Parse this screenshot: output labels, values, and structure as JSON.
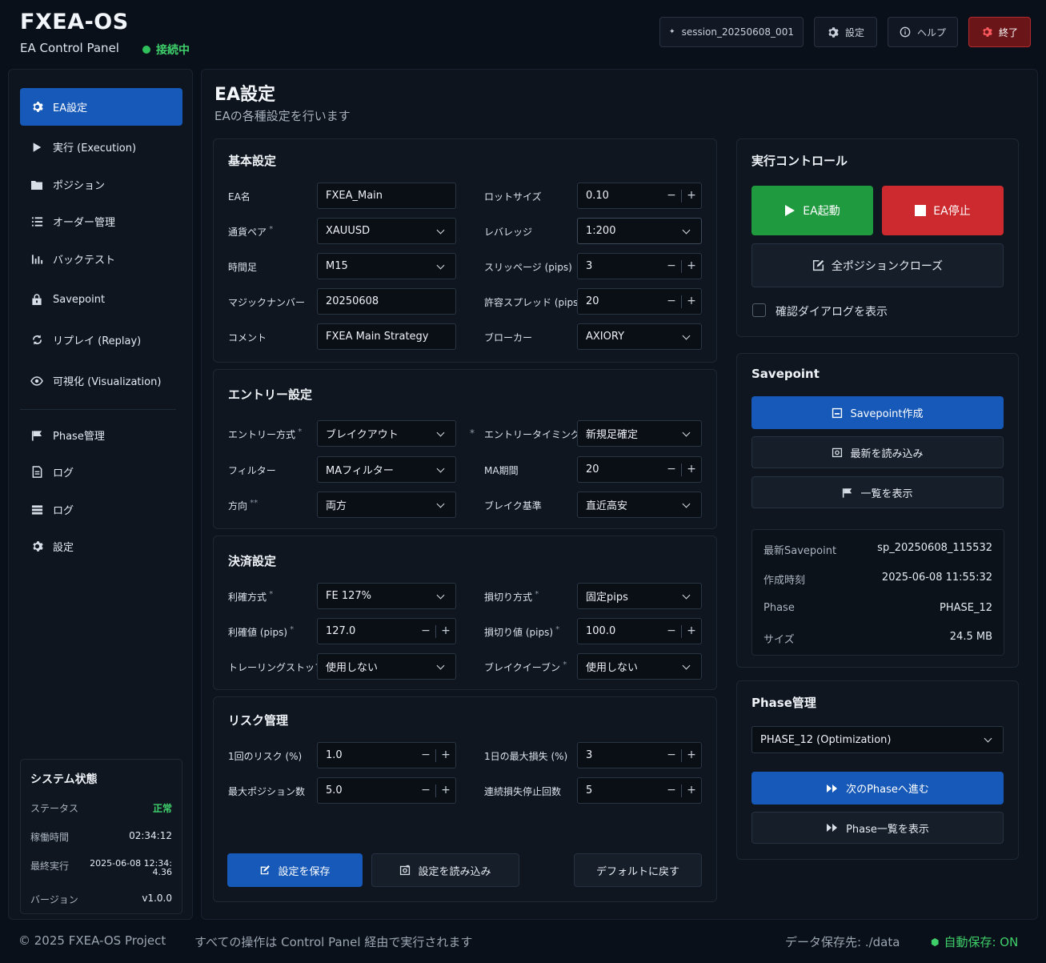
{
  "app": {
    "name": "FXEA-OS",
    "subtitle": "EA Control Panel",
    "status": "接続中"
  },
  "header": {
    "session": "session_20250608_001",
    "settings": "設定",
    "help": "ヘルプ",
    "exit": "終了"
  },
  "sidebar": {
    "items": [
      {
        "label": "EA設定",
        "icon": "gear-icon"
      },
      {
        "label": "実行 (Execution)",
        "icon": "play-icon"
      },
      {
        "label": "ポジション",
        "icon": "folder-icon"
      },
      {
        "label": "オーダー管理",
        "icon": "list-icon"
      },
      {
        "label": "バックテスト",
        "icon": "chart-icon"
      },
      {
        "label": "Savepoint",
        "icon": "lock-icon"
      },
      {
        "label": "リプレイ (Replay)",
        "icon": "replay-icon"
      },
      {
        "label": "可視化 (Visualization)",
        "icon": "eye-icon"
      },
      {
        "label": "Phase管理",
        "icon": "flag-icon"
      },
      {
        "label": "ログ",
        "icon": "document-icon"
      },
      {
        "label": "ログ",
        "icon": "stack-icon"
      },
      {
        "label": "設定",
        "icon": "gear-icon"
      }
    ],
    "system": {
      "title": "システム状態",
      "status_label": "ステータス",
      "status_value": "正常",
      "uptime_label": "稼働時間",
      "uptime_value": "02:34:12",
      "last_label": "最終実行",
      "last_value_1": "2025-06-08 12:34:",
      "last_value_2": "4.36",
      "version_label": "バージョン",
      "version_value": "v1.0.0"
    }
  },
  "page": {
    "title": "EA設定",
    "subtitle": "EAの各種設定を行います"
  },
  "basic": {
    "title": "基本設定",
    "ea_name_label": "EA名",
    "ea_name": "FXEA_Main",
    "pair_label": "通貨ペア",
    "pair": "XAUUSD",
    "timeframe_label": "時間足",
    "timeframe": "M15",
    "magic_label": "マジックナンバー",
    "magic": "20250608",
    "comment_label": "コメント",
    "comment": "FXEA Main Strategy",
    "lot_label": "ロットサイズ",
    "lot": "0.10",
    "leverage_label": "レバレッジ",
    "leverage": "1:200",
    "slippage_label": "スリッページ (pips)",
    "slippage": "3",
    "spread_label": "許容スプレッド (pips)",
    "spread": "20",
    "broker_label": "ブローカー",
    "broker": "AXIORY"
  },
  "entry": {
    "title": "エントリー設定",
    "method_label": "エントリー方式",
    "method": "ブレイクアウト",
    "filter_label": "フィルター",
    "filter": "MAフィルター",
    "direction_label": "方向",
    "direction": "両方",
    "timing_label": "エントリータイミング",
    "timing": "新規足確定",
    "ma_label": "MA期間",
    "ma": "20",
    "break_label": "ブレイク基準",
    "break": "直近高安"
  },
  "exit": {
    "title": "決済設定",
    "tp_method_label": "利確方式",
    "tp_method": "FE 127%",
    "tp_value_label": "利確値 (pips)",
    "tp_value": "127.0",
    "trailing_label": "トレーリングストップ",
    "trailing": "使用しない",
    "sl_method_label": "損切り方式",
    "sl_method": "固定pips",
    "sl_value_label": "損切り値 (pips)",
    "sl_value": "100.0",
    "breakeven_label": "ブレイクイーブン",
    "breakeven": "使用しない"
  },
  "risk": {
    "title": "リスク管理",
    "risk_label": "1回のリスク (%)",
    "risk": "1.0",
    "maxpos_label": "最大ポジション数",
    "maxpos": "5.0",
    "daily_label": "1日の最大損失 (%)",
    "daily": "3",
    "consec_label": "連続損失停止回数",
    "consec": "5"
  },
  "actions": {
    "save": "設定を保存",
    "load": "設定を読み込み",
    "default": "デフォルトに戻す"
  },
  "control": {
    "title": "実行コントロール",
    "start": "EA起動",
    "stop": "EA停止",
    "close_all": "全ポジションクローズ",
    "confirm": "確認ダイアログを表示"
  },
  "savepoint": {
    "title": "Savepoint",
    "create": "Savepoint作成",
    "load_latest": "最新を読み込み",
    "list": "一覧を表示",
    "latest_label": "最新Savepoint",
    "latest": "sp_20250608_115532",
    "created_label": "作成時刻",
    "created": "2025-06-08 11:55:32",
    "phase_label": "Phase",
    "phase": "PHASE_12",
    "size_label": "サイズ",
    "size": "24.5 MB"
  },
  "phase": {
    "title": "Phase管理",
    "current": "PHASE_12 (Optimization)",
    "next": "次のPhaseへ進む",
    "list": "Phase一覧を表示"
  },
  "footer": {
    "copyright": "© 2025 FXEA-OS Project",
    "note": "すべての操作は Control Panel 経由で実行されます",
    "data_path": "データ保存先: ./data",
    "autosave": "自動保存: ON"
  },
  "colors": {
    "accent": "#1659b8",
    "success": "#2fbf5b",
    "danger": "#cc2a2e",
    "start": "#1f9a3e"
  }
}
